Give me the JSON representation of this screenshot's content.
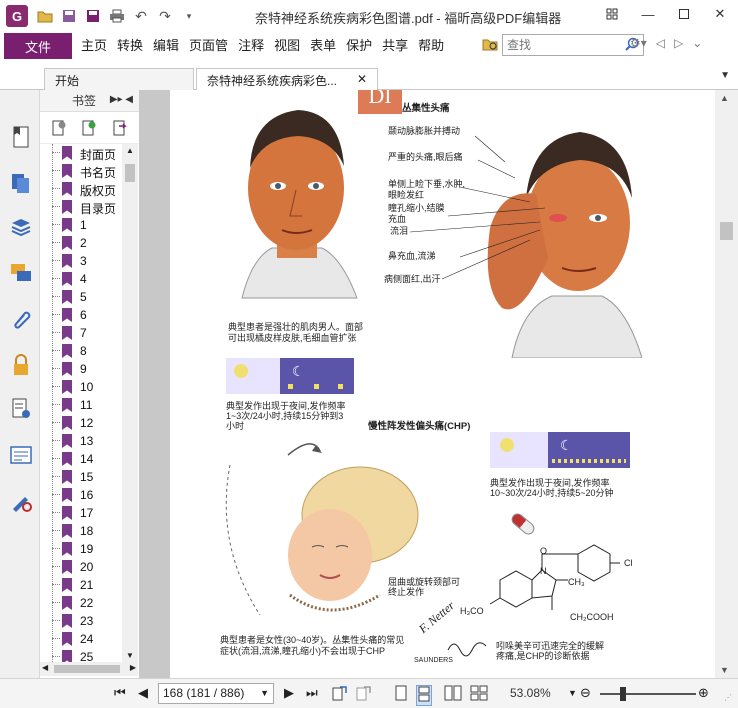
{
  "app": {
    "logo": "G",
    "title": "奈特神经系统疾病彩色图谱.pdf - 福昕高级PDF编辑器",
    "quick_access_icons": [
      "open-folder-icon",
      "save-icon",
      "save-as-icon",
      "print-icon",
      "undo-icon",
      "redo-icon",
      "customize-icon"
    ],
    "window_controls": [
      "restore-layout-icon",
      "minimize-icon",
      "maximize-icon",
      "close-icon"
    ]
  },
  "menu": {
    "file": "文件",
    "items": [
      "主页",
      "转换",
      "编辑",
      "页面管",
      "注释",
      "视图",
      "表单",
      "保护",
      "共享",
      "帮助"
    ],
    "search_placeholder": "查找"
  },
  "tabs": {
    "start": "开始",
    "doc": "奈特神经系统疾病彩色..."
  },
  "bookmarks": {
    "header": "书签",
    "items": [
      "封面页",
      "书名页",
      "版权页",
      "目录页",
      "1",
      "2",
      "3",
      "4",
      "5",
      "6",
      "7",
      "8",
      "9",
      "10",
      "11",
      "12",
      "13",
      "14",
      "15",
      "16",
      "17",
      "18",
      "19",
      "20",
      "21",
      "22",
      "23",
      "24",
      "25"
    ]
  },
  "page_content": {
    "cluster_title": "丛集性头痛",
    "labels": [
      "颞动脉膨胀并搏动",
      "严重的头痛,眼后痛",
      "单侧上睑下垂,水肿,眼睑发红",
      "瞳孔缩小,结膜充血",
      "流泪",
      "鼻充血,流涕",
      "病侧面红,出汗"
    ],
    "caption_male": [
      "典型患者是强壮的肌肉男人。面部",
      "可出现橘皮样皮肤,毛细血管扩张"
    ],
    "caption_cluster_freq": [
      "典型发作出现于夜间,发作频率",
      "1~3次/24小时,持续15分钟到3",
      "小时"
    ],
    "chp_title": "慢性阵发性偏头痛(CHP)",
    "caption_chp_freq": [
      "典型发作出现于夜间,发作频率",
      "10~30次/24小时,持续5~20分钟"
    ],
    "caption_neck": [
      "屈曲或旋转颈部可",
      "终止发作"
    ],
    "caption_female": [
      "典型患者是女性(30~40岁)。丛集性头痛的常见",
      "症状(流泪,流涕,瞳孔缩小)不会出现于CHP"
    ],
    "caption_indomethacin": [
      "吲哚美辛可迅速完全的缓解",
      "疼痛,是CHP的诊断依据"
    ],
    "chem_labels": [
      "O",
      "N",
      "CH₃",
      "CH₂COOH",
      "H₃CO",
      "Cl"
    ],
    "signature": "F. Netter",
    "saunders": "SAUNDERS"
  },
  "status": {
    "page_field": "168 (181 / 886)",
    "zoom": "53.08%"
  },
  "colors": {
    "accent": "#7a1f6f",
    "night_bar": "#5a55a8",
    "bookmark_flag": "#7a3a8a"
  }
}
